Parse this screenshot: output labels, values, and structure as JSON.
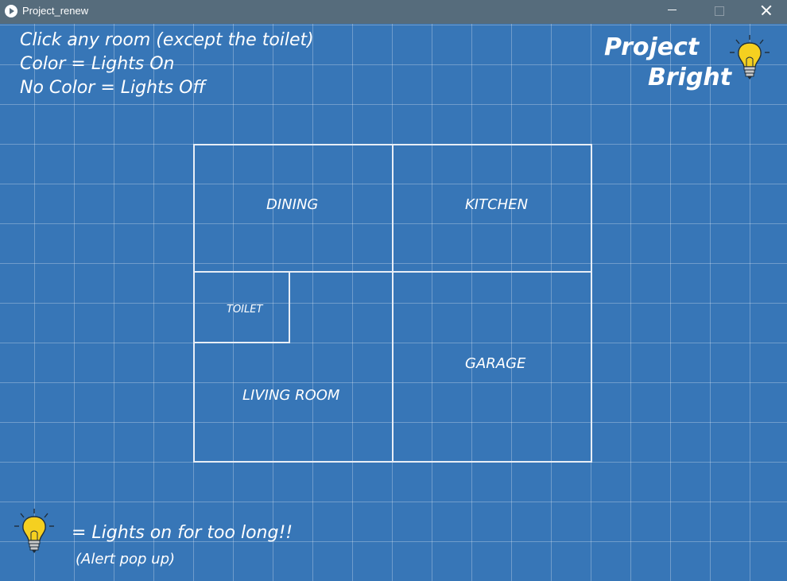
{
  "window": {
    "title": "Project_renew"
  },
  "instructions": {
    "line1": "Click any room (except the toilet)",
    "line2": "Color = Lights On",
    "line3": "No Color = Lights Off"
  },
  "brand": {
    "line1": "Project",
    "line2": "Bright",
    "icon": "lightbulb-icon"
  },
  "rooms": {
    "dining": "DINING",
    "kitchen": "KITCHEN",
    "toilet": "TOILET",
    "living": "LIVING ROOM",
    "garage": "GARAGE"
  },
  "legend": {
    "text": "= Lights on for too long!!",
    "sub": "(Alert pop up)",
    "icon": "lightbulb-icon"
  },
  "colors": {
    "background": "#3776b7",
    "titlebar": "#566c7c",
    "lines": "#e8eef6",
    "bulb": "#f5d020"
  }
}
